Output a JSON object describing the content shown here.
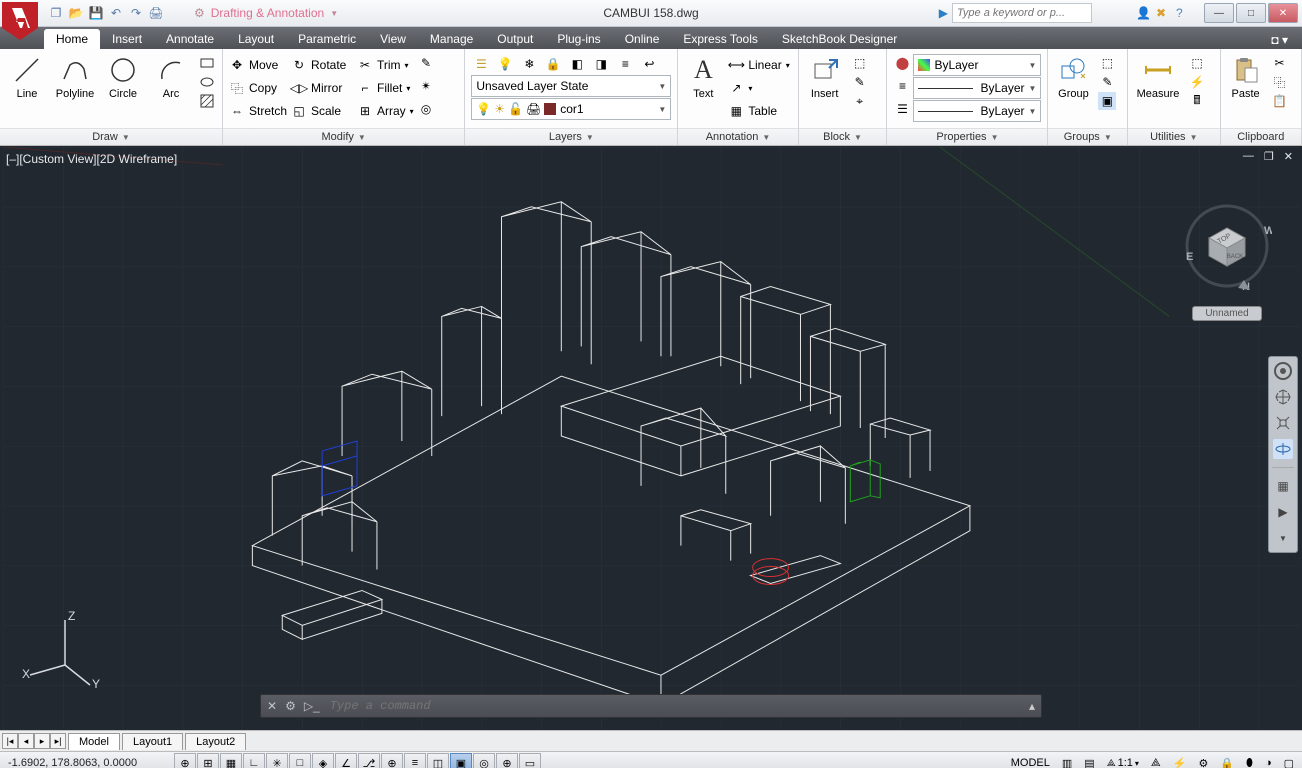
{
  "title_filename": "CAMBUI 158.dwg",
  "workspace": "Drafting & Annotation",
  "search_placeholder": "Type a keyword or p...",
  "tabs": [
    "Home",
    "Insert",
    "Annotate",
    "Layout",
    "Parametric",
    "View",
    "Manage",
    "Output",
    "Plug-ins",
    "Online",
    "Express Tools",
    "SketchBook Designer"
  ],
  "active_tab": "Home",
  "draw": {
    "line": "Line",
    "polyline": "Polyline",
    "circle": "Circle",
    "arc": "Arc",
    "label": "Draw"
  },
  "modify": {
    "move": "Move",
    "rotate": "Rotate",
    "trim": "Trim",
    "copy": "Copy",
    "mirror": "Mirror",
    "fillet": "Fillet",
    "stretch": "Stretch",
    "scale": "Scale",
    "array": "Array",
    "label": "Modify"
  },
  "layers": {
    "state": "Unsaved Layer State",
    "current": "cor1",
    "label": "Layers"
  },
  "annotation": {
    "text": "Text",
    "linear": "Linear",
    "leader": "",
    "table": "Table",
    "label": "Annotation"
  },
  "block": {
    "insert": "Insert",
    "label": "Block"
  },
  "properties": {
    "bylayer": "ByLayer",
    "label": "Properties"
  },
  "groups": {
    "group": "Group",
    "label": "Groups"
  },
  "utilities": {
    "measure": "Measure",
    "label": "Utilities"
  },
  "clipboard": {
    "paste": "Paste",
    "label": "Clipboard"
  },
  "view_label": "[–][Custom View][2D Wireframe]",
  "viewcube": {
    "top": "TOP",
    "back": "BACK",
    "w": "W",
    "e": "E",
    "n": "N",
    "tag": "Unnamed"
  },
  "ucs": {
    "x": "X",
    "y": "Y",
    "z": "Z"
  },
  "cmd_placeholder": "Type a command",
  "model_tabs": [
    "Model",
    "Layout1",
    "Layout2"
  ],
  "active_model_tab": "Model",
  "coords": "-1.6902, 178.8063, 0.0000",
  "status_right": {
    "model": "MODEL",
    "scale": "1:1"
  }
}
